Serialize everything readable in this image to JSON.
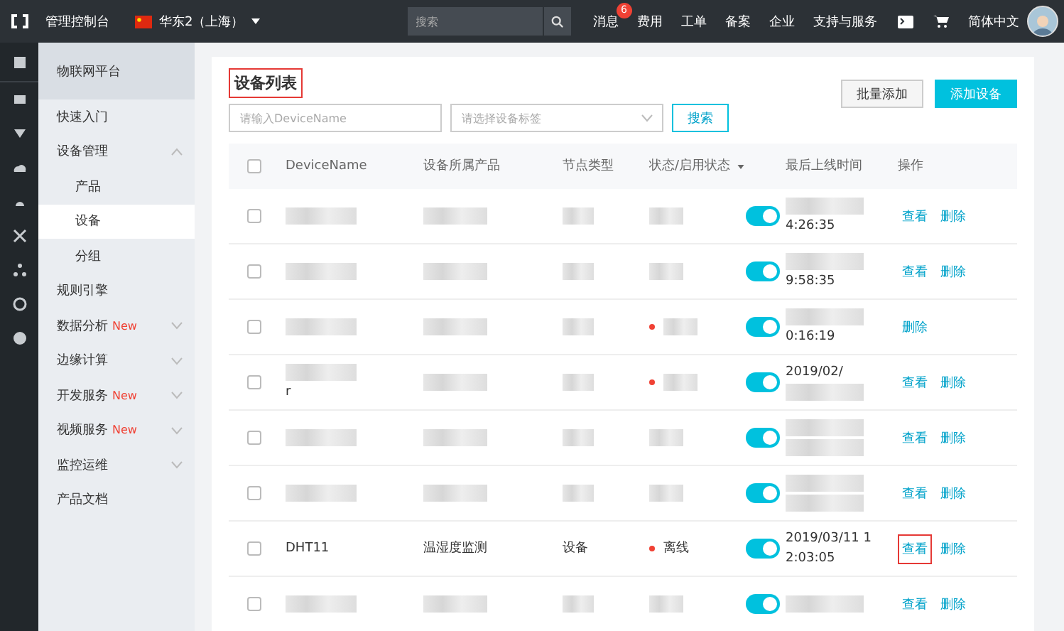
{
  "topbar": {
    "console": "管理控制台",
    "region": "华东2（上海）",
    "search": {
      "placeholder": "搜索"
    },
    "links": [
      {
        "label": "消息",
        "badge": "6"
      },
      {
        "label": "费用"
      },
      {
        "label": "工单"
      },
      {
        "label": "备案"
      },
      {
        "label": "企业"
      },
      {
        "label": "支持与服务"
      }
    ],
    "language": "简体中文"
  },
  "sidebar": {
    "title": "物联网平台",
    "items": [
      {
        "label": "快速入门"
      },
      {
        "label": "设备管理",
        "expanded": true,
        "children": [
          {
            "label": "产品",
            "selected": false
          },
          {
            "label": "设备",
            "selected": true
          },
          {
            "label": "分组",
            "selected": false
          }
        ]
      },
      {
        "label": "规则引擎"
      },
      {
        "label": "数据分析",
        "badge": "New",
        "expanded": false
      },
      {
        "label": "边缘计算",
        "expanded": false
      },
      {
        "label": "开发服务",
        "badge": "New",
        "expanded": false
      },
      {
        "label": "视频服务",
        "badge": "New",
        "expanded": false
      },
      {
        "label": "监控运维",
        "expanded": false
      },
      {
        "label": "产品文档"
      }
    ]
  },
  "page": {
    "title": "设备列表",
    "title_highlighted": true,
    "buttons": [
      {
        "label": "批量添加",
        "primary": false
      },
      {
        "label": "添加设备",
        "primary": true
      }
    ],
    "name_filter": {
      "placeholder": "请输入DeviceName"
    },
    "tag_filter": {
      "placeholder": "请选择设备标签"
    },
    "search_button": "搜索",
    "all_checked": false,
    "columns": [
      "DeviceName",
      "设备所属产品",
      "节点类型",
      "状态/启用状态",
      "最后上线时间",
      "操作"
    ],
    "rows": [
      {
        "checked": false,
        "name": [
          {
            "kind": "blur"
          }
        ],
        "product": [
          {
            "kind": "blur"
          }
        ],
        "node": [
          {
            "kind": "blur"
          }
        ],
        "status": [
          {
            "kind": "blur"
          }
        ],
        "enabled": true,
        "time": [
          {
            "kind": "blur"
          },
          {
            "kind": "text",
            "text": "4:26:35"
          }
        ],
        "actions": [
          {
            "label": "查看",
            "highlighted": false
          },
          {
            "label": "删除",
            "highlighted": false
          }
        ]
      },
      {
        "checked": false,
        "name": [
          {
            "kind": "blur"
          }
        ],
        "product": [
          {
            "kind": "blur"
          }
        ],
        "node": [
          {
            "kind": "blur"
          }
        ],
        "status": [
          {
            "kind": "blur"
          }
        ],
        "enabled": true,
        "time": [
          {
            "kind": "blur"
          },
          {
            "kind": "text",
            "text": "9:58:35"
          }
        ],
        "actions": [
          {
            "label": "查看",
            "highlighted": false
          },
          {
            "label": "删除",
            "highlighted": false
          }
        ]
      },
      {
        "checked": false,
        "name": [
          {
            "kind": "blur"
          }
        ],
        "product": [
          {
            "kind": "blur"
          }
        ],
        "node": [
          {
            "kind": "blur"
          }
        ],
        "status": [
          {
            "kind": "blur"
          }
        ],
        "color": "#f04134",
        "enabled": true,
        "time": [
          {
            "kind": "blur"
          },
          {
            "kind": "text",
            "text": "0:16:19"
          }
        ],
        "actions": [
          {
            "label": "删除",
            "highlighted": false
          }
        ]
      },
      {
        "checked": false,
        "name": [
          {
            "kind": "blur"
          },
          {
            "kind": "text",
            "text": "r"
          }
        ],
        "product": [
          {
            "kind": "blur"
          }
        ],
        "node": [
          {
            "kind": "blur"
          }
        ],
        "status": [
          {
            "kind": "blur"
          }
        ],
        "color": "#f04134",
        "enabled": true,
        "time": [
          {
            "kind": "text",
            "text": "2019/02/"
          },
          {
            "kind": "blur"
          }
        ],
        "actions": [
          {
            "label": "查看",
            "highlighted": false
          },
          {
            "label": "删除",
            "highlighted": false
          }
        ]
      },
      {
        "checked": false,
        "name": [
          {
            "kind": "blur"
          }
        ],
        "product": [
          {
            "kind": "blur"
          }
        ],
        "node": [
          {
            "kind": "blur"
          }
        ],
        "status": [
          {
            "kind": "blur"
          }
        ],
        "enabled": true,
        "time": [
          {
            "kind": "blur"
          },
          {
            "kind": "blur"
          }
        ],
        "actions": [
          {
            "label": "查看",
            "highlighted": false
          },
          {
            "label": "删除",
            "highlighted": false
          }
        ]
      },
      {
        "checked": false,
        "name": [
          {
            "kind": "blur"
          }
        ],
        "product": [
          {
            "kind": "blur"
          }
        ],
        "node": [
          {
            "kind": "blur"
          }
        ],
        "status": [
          {
            "kind": "blur"
          }
        ],
        "enabled": true,
        "time": [
          {
            "kind": "blur"
          },
          {
            "kind": "blur"
          }
        ],
        "actions": [
          {
            "label": "查看",
            "highlighted": false
          },
          {
            "label": "删除",
            "highlighted": false
          }
        ]
      },
      {
        "checked": false,
        "name": [
          {
            "kind": "text",
            "text": "DHT11"
          }
        ],
        "product": [
          {
            "kind": "text",
            "text": "温湿度监测"
          }
        ],
        "node": [
          {
            "kind": "text",
            "text": "设备"
          }
        ],
        "status": [
          {
            "kind": "text",
            "text": "离线"
          }
        ],
        "color": "#f04134",
        "enabled": true,
        "time": [
          {
            "kind": "text",
            "text": "2019/03/11 1"
          },
          {
            "kind": "text",
            "text": "2:03:05"
          }
        ],
        "actions": [
          {
            "label": "查看",
            "highlighted": true
          },
          {
            "label": "删除",
            "highlighted": false
          }
        ]
      },
      {
        "checked": false,
        "name": [
          {
            "kind": "blur"
          }
        ],
        "product": [
          {
            "kind": "blur"
          }
        ],
        "node": [
          {
            "kind": "blur"
          }
        ],
        "status": [
          {
            "kind": "blur"
          }
        ],
        "enabled": true,
        "time": [
          {
            "kind": "blur"
          }
        ],
        "actions": [
          {
            "label": "查看",
            "highlighted": false
          },
          {
            "label": "删除",
            "highlighted": false
          }
        ]
      }
    ]
  }
}
